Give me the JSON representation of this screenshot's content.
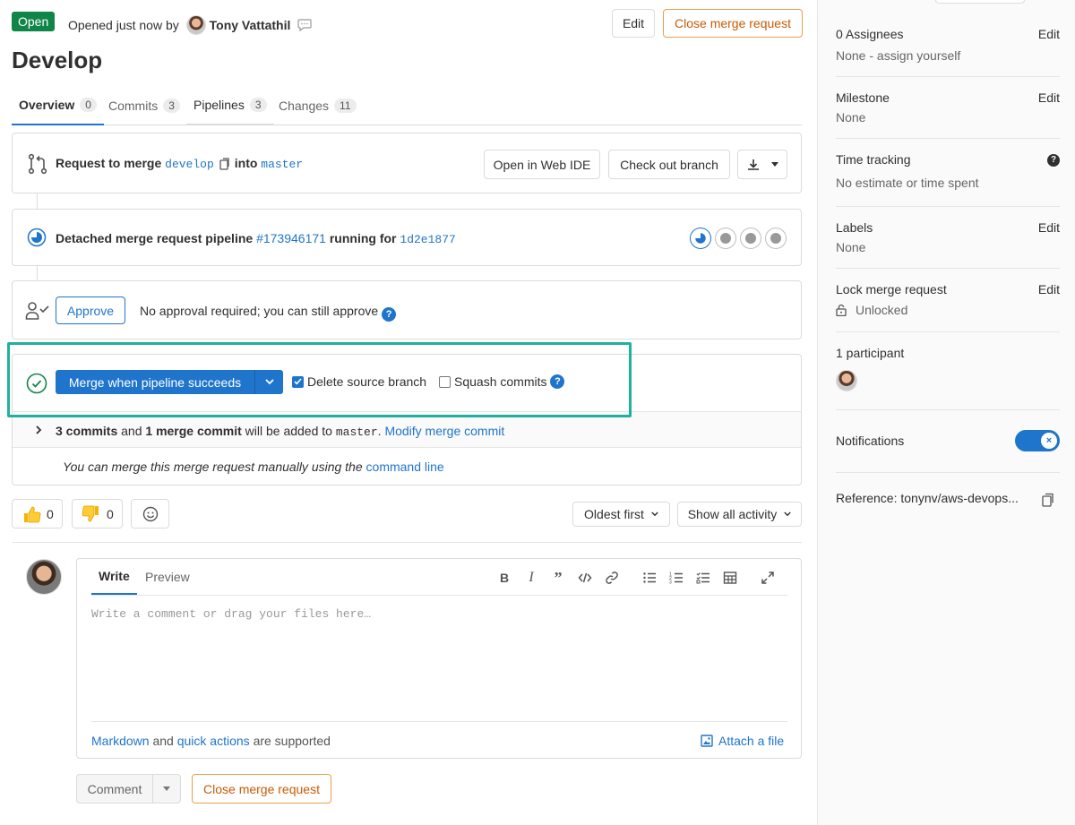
{
  "header": {
    "status": "Open",
    "opened_prefix": "Opened just now by",
    "author": "Tony Vattathil",
    "edit_label": "Edit",
    "close_label": "Close merge request"
  },
  "title": "Develop",
  "tabs": [
    {
      "label": "Overview",
      "count": "0"
    },
    {
      "label": "Commits",
      "count": "3"
    },
    {
      "label": "Pipelines",
      "count": "3"
    },
    {
      "label": "Changes",
      "count": "11"
    }
  ],
  "merge_request": {
    "prefix": "Request to merge",
    "source": "develop",
    "into": "into",
    "target": "master",
    "webide_label": "Open in Web IDE",
    "checkout_label": "Check out branch"
  },
  "pipeline": {
    "prefix": "Detached merge request pipeline",
    "id": "#173946171",
    "middle": "running for",
    "commit": "1d2e1877"
  },
  "approval": {
    "button": "Approve",
    "text": "No approval required; you can still approve",
    "help": "?"
  },
  "merge": {
    "button": "Merge when pipeline succeeds",
    "delete_source": "Delete source branch",
    "squash": "Squash commits",
    "commits_count": "3 commits",
    "and": "and",
    "merge_commit": "1 merge commit",
    "added_to": "will be added to",
    "branch": "master",
    "dot": ".",
    "modify_link": "Modify merge commit",
    "manual_text": "You can merge this merge request manually using the",
    "command_line": "command line"
  },
  "awards": {
    "thumbs_up_count": "0",
    "thumbs_down_count": "0"
  },
  "sort": {
    "order": "Oldest first",
    "filter": "Show all activity"
  },
  "editor": {
    "write_tab": "Write",
    "preview_tab": "Preview",
    "placeholder": "Write a comment or drag your files here…",
    "markdown_link": "Markdown",
    "and": "and",
    "quick_actions_link": "quick actions",
    "supported": "are supported",
    "attach": "Attach a file",
    "toolbar_icons": [
      "bold-icon",
      "italic-icon",
      "quote-icon",
      "code-icon",
      "link-icon",
      "bullet-list-icon",
      "numbered-list-icon",
      "task-list-icon",
      "table-icon",
      "fullscreen-icon"
    ]
  },
  "comment_actions": {
    "comment": "Comment",
    "close": "Close merge request"
  },
  "sidebar": {
    "assignees_title": "0 Assignees",
    "assignees_value": "None - assign yourself",
    "milestone_title": "Milestone",
    "milestone_value": "None",
    "time_title": "Time tracking",
    "time_value": "No estimate or time spent",
    "labels_title": "Labels",
    "labels_value": "None",
    "lock_title": "Lock merge request",
    "lock_value": "Unlocked",
    "participants_title": "1 participant",
    "notifications_title": "Notifications",
    "reference": "Reference: tonynv/aws-devops...",
    "edit_label": "Edit",
    "help": "?"
  },
  "colors": {
    "accent": "#1f75cb",
    "open_badge": "#108548",
    "close_button": "#c95a04",
    "highlight": "#1fb19e"
  }
}
